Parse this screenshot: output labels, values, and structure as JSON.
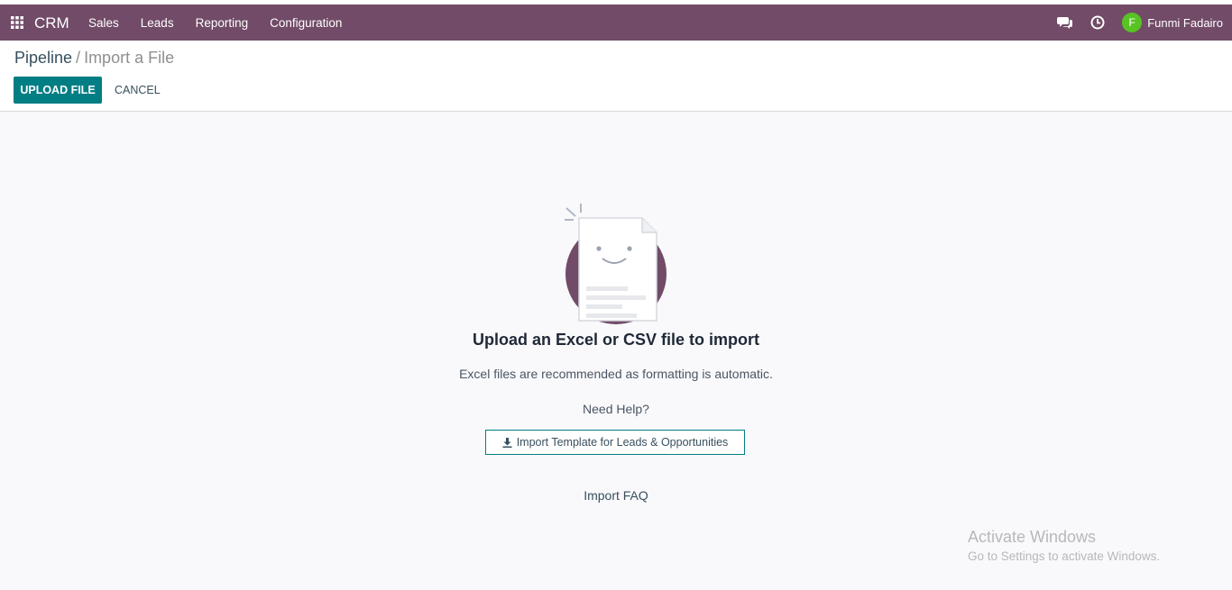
{
  "navbar": {
    "app_name": "CRM",
    "menu": [
      {
        "label": "Sales"
      },
      {
        "label": "Leads"
      },
      {
        "label": "Reporting"
      },
      {
        "label": "Configuration"
      }
    ],
    "icons": [
      "apps-grid-icon",
      "chat-icon",
      "clock-icon"
    ],
    "user": {
      "initial": "F",
      "name": "Funmi Fadairo"
    },
    "colors": {
      "background": "#714b67",
      "avatar": "#58c322"
    }
  },
  "breadcrumb": {
    "parent": "Pipeline",
    "separator": "/",
    "current": "Import a File"
  },
  "actions": {
    "upload_label": "UPLOAD FILE",
    "cancel_label": "CANCEL",
    "primary_color": "#017e84"
  },
  "content": {
    "title": "Upload an Excel or CSV file to import",
    "subtitle": "Excel files are recommended as formatting is automatic.",
    "help_text": "Need Help?",
    "template_button": "Import Template for Leads & Opportunities",
    "faq_link": "Import FAQ",
    "illustration_icon": "smiling-document-icon"
  },
  "watermark": {
    "title": "Activate Windows",
    "subtitle": "Go to Settings to activate Windows."
  }
}
